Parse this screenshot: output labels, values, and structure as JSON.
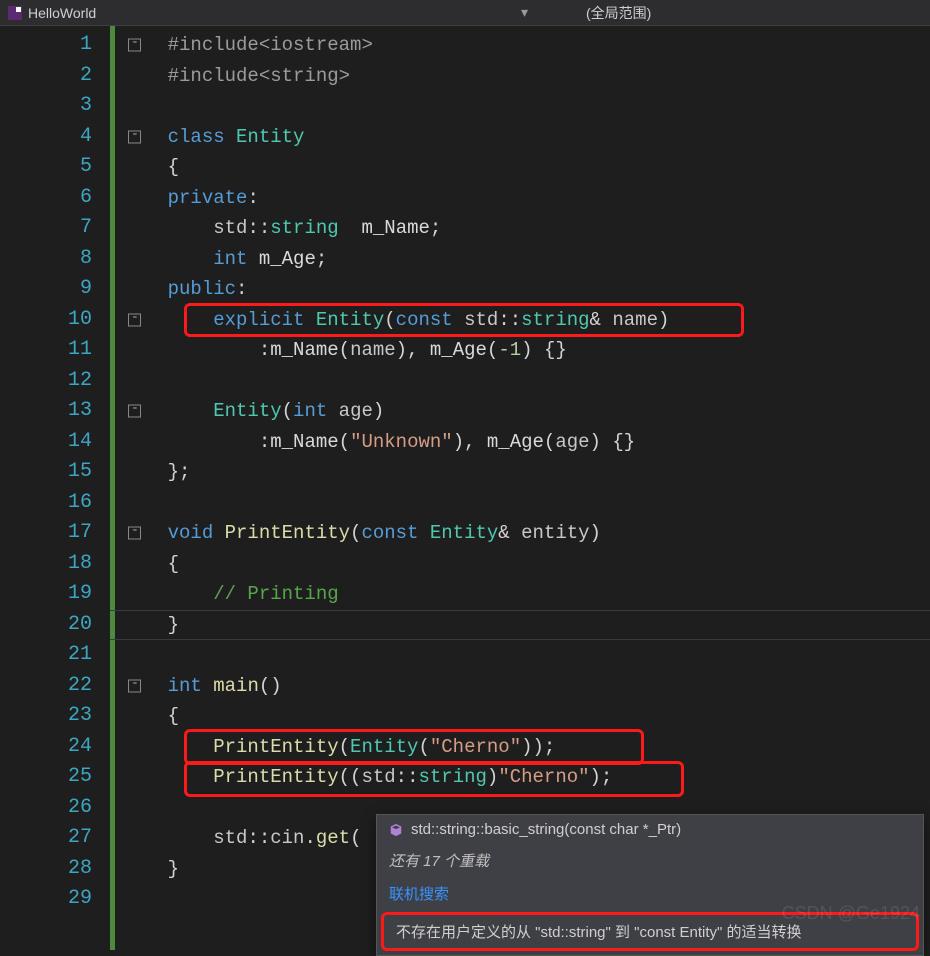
{
  "topbar": {
    "file_name": "HelloWorld",
    "scope": "(全局范围)",
    "dropdown_glyph": "▾"
  },
  "gutter": {
    "start": 1,
    "end": 29
  },
  "code": {
    "l1": {
      "inc": "#include",
      "hdr": "<iostream>"
    },
    "l2": {
      "inc": "#include",
      "hdr": "<string>"
    },
    "l4": {
      "kw": "class",
      "name": "Entity"
    },
    "l5": {
      "brace": "{"
    },
    "l6": {
      "kw": "private",
      "colon": ":"
    },
    "l7": {
      "ns": "std",
      "ty": "string",
      "var": "m_Name",
      "semi": ";"
    },
    "l8": {
      "ty": "int",
      "var": "m_Age",
      "semi": ";"
    },
    "l9": {
      "kw": "public",
      "colon": ":"
    },
    "l10": {
      "kw": "explicit",
      "ctor": "Entity",
      "p1": "const",
      "ns": "std",
      "ty": "string",
      "amp": "&",
      "arg": "name"
    },
    "l11": {
      "m1": "m_Name",
      "a1": "name",
      "m2": "m_Age",
      "a2": "-1",
      "body": "{}"
    },
    "l13": {
      "ctor": "Entity",
      "ty": "int",
      "arg": "age"
    },
    "l14": {
      "m1": "m_Name",
      "a1": "\"Unknown\"",
      "m2": "m_Age",
      "a2": "age",
      "body": "{}"
    },
    "l15": {
      "close": "};"
    },
    "l17": {
      "ty": "void",
      "fn": "PrintEntity",
      "p1": "const",
      "cls": "Entity",
      "amp": "&",
      "arg": "entity"
    },
    "l18": {
      "brace": "{"
    },
    "l19": {
      "cm": "// Printing"
    },
    "l20": {
      "brace": "}"
    },
    "l22": {
      "ty": "int",
      "fn": "main",
      "pp": "()"
    },
    "l23": {
      "brace": "{"
    },
    "l24": {
      "fn": "PrintEntity",
      "cls": "Entity",
      "s": "\"Cherno\"",
      "tail": ");"
    },
    "l25": {
      "fn": "PrintEntity",
      "ns": "std",
      "ty": "string",
      "s": "\"Cherno\"",
      "tail": ");"
    },
    "l27": {
      "ns": "std",
      "obj": "cin",
      "m": "get"
    },
    "l28": {
      "brace": "}"
    }
  },
  "tooltip": {
    "signature": "std::string::basic_string(const char *_Ptr)",
    "overloads": "还有 17 个重载",
    "link": "联机搜索",
    "error": "不存在用户定义的从 \"std::string\" 到 \"const Entity\" 的适当转换"
  },
  "watermark": "CSDN @Ge1924"
}
